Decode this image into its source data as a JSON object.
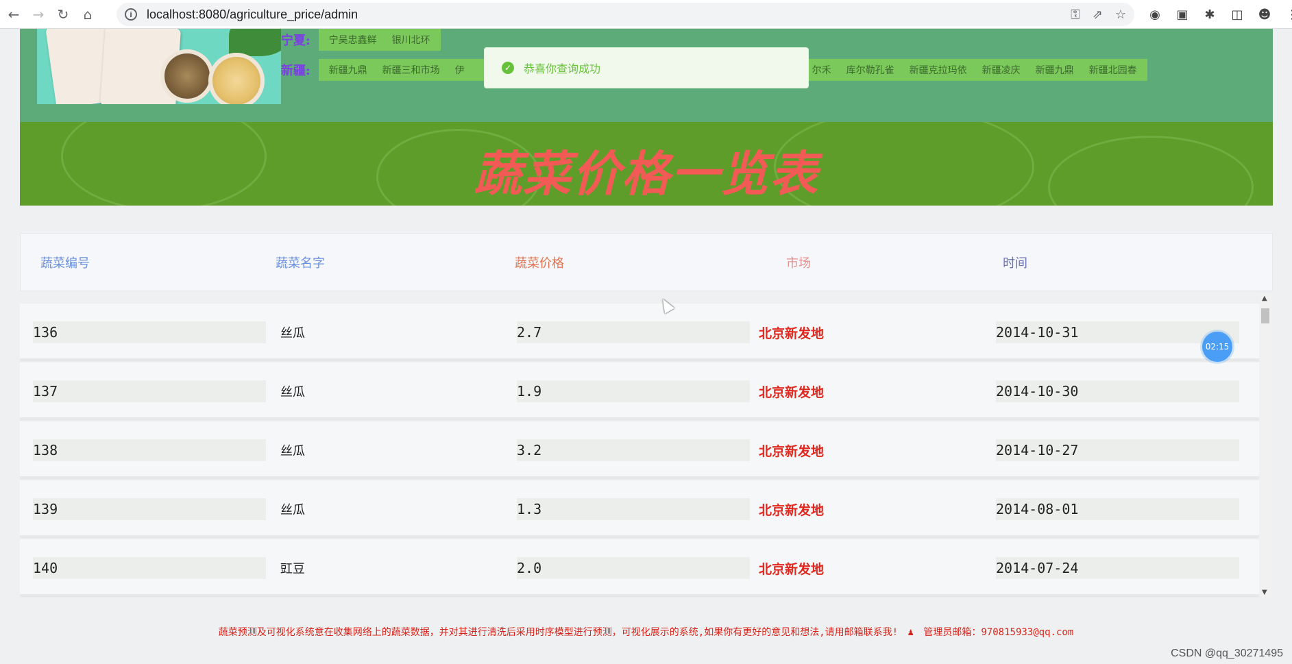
{
  "browser": {
    "url": "localhost:8080/agriculture_price/admin"
  },
  "regions": [
    {
      "label": "宁夏:",
      "tags": [
        "宁吴忠鑫鲜",
        "银川北环"
      ]
    },
    {
      "label": "新疆:",
      "tags": [
        "新疆九鼎",
        "新疆三和市场",
        "伊",
        "尔禾",
        "库尔勒孔雀",
        "新疆克拉玛依",
        "新疆凌庆",
        "新疆九鼎",
        "新疆北园春"
      ]
    }
  ],
  "toast": {
    "message": "恭喜你查询成功"
  },
  "banner": {
    "title": "蔬菜价格一览表"
  },
  "table": {
    "headers": [
      {
        "label": "蔬菜编号",
        "color": "#6a8fdc"
      },
      {
        "label": "蔬菜名字",
        "color": "#6a8fdc"
      },
      {
        "label": "蔬菜价格",
        "color": "#e0734f"
      },
      {
        "label": "市场",
        "color": "#e58f8f"
      },
      {
        "label": "时间",
        "color": "#6a71b8"
      }
    ],
    "rows": [
      {
        "id": "136",
        "name": "丝瓜",
        "price": "2.7",
        "market": "北京新发地",
        "date": "2014-10-31"
      },
      {
        "id": "137",
        "name": "丝瓜",
        "price": "1.9",
        "market": "北京新发地",
        "date": "2014-10-30"
      },
      {
        "id": "138",
        "name": "丝瓜",
        "price": "3.2",
        "market": "北京新发地",
        "date": "2014-10-27"
      },
      {
        "id": "139",
        "name": "丝瓜",
        "price": "1.3",
        "market": "北京新发地",
        "date": "2014-08-01"
      },
      {
        "id": "140",
        "name": "豇豆",
        "price": "2.0",
        "market": "北京新发地",
        "date": "2014-07-24"
      }
    ]
  },
  "timer": "02:15",
  "footer": {
    "text": "蔬菜预测及可视化系统意在收集网络上的蔬菜数据，并对其进行清洗后采用时序模型进行预测，可视化展示的系统,如果你有更好的意见和想法,请用邮箱联系我!",
    "email": "管理员邮箱：970815933@qq.com"
  },
  "watermark": "CSDN @qq_30271495"
}
